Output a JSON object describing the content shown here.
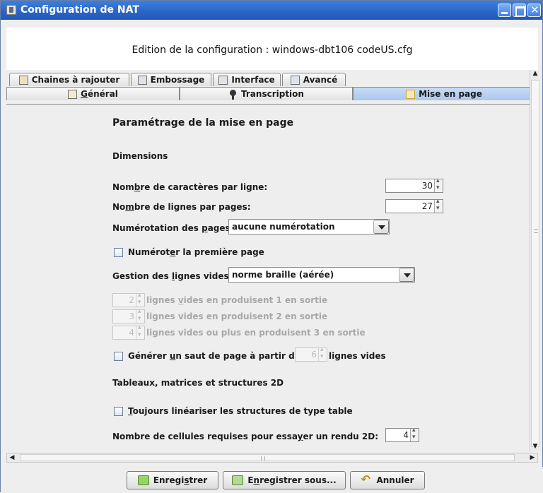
{
  "window": {
    "title": "Configuration de NAT"
  },
  "dialog": {
    "title": "Edition de la configuration : windows-dbt106 codeUS.cfg"
  },
  "tabs": {
    "row1": [
      "Chaines à rajouter",
      "Embossage",
      "Interface",
      "Avancé"
    ],
    "row2": {
      "general_pre": "",
      "general_u": "G",
      "general_post": "énéral",
      "transcription": "Transcription",
      "mise_en_page": "Mise en page"
    },
    "selected": "Mise en page"
  },
  "content": {
    "heading": "Paramétrage de la mise en page",
    "dimensions_title": "Dimensions",
    "chars_per_line": {
      "pre": "Nom",
      "u": "b",
      "post": "re de caractères par ligne:",
      "value": "30"
    },
    "lines_per_page": {
      "pre": "No",
      "u": "m",
      "post": "bre de lignes par pages:",
      "value": "27"
    },
    "page_numbering": {
      "pre": "Numérotation des ",
      "u": "p",
      "post": "ages:",
      "value": "aucune numérotation"
    },
    "number_first_page": {
      "pre": "Numérot",
      "u": "e",
      "post": "r la première page",
      "checked": false
    },
    "blank_lines": {
      "pre": "Gestion des ",
      "u": "l",
      "post": "ignes vides:",
      "value": "norme braille (aérée)"
    },
    "blank_rule_1": {
      "value": "2",
      "pre": "lignes ",
      "u": "v",
      "post": "ides en produisent 1 en sortie"
    },
    "blank_rule_2": {
      "value": "3",
      "label": "lignes vides en produisent 2 en sortie"
    },
    "blank_rule_3": {
      "value": "4",
      "label": "lignes vides ou plus en produisent 3 en sortie"
    },
    "page_break": {
      "pre": "Générer ",
      "u": "u",
      "post": "n saut de page à partir de",
      "value": "6",
      "suffix": "lignes vides",
      "checked": false
    },
    "tables_title": "Tableaux, matrices et structures 2D",
    "linearize": {
      "u": "T",
      "post": "oujours linéariser les structures de type table",
      "checked": false
    },
    "cells_required": {
      "pre": "Nombre de cellules requises pour essa",
      "u": "y",
      "post": "er un rendu 2D:",
      "value": "4"
    }
  },
  "buttons": {
    "save": {
      "pre": "Enregi",
      "u": "s",
      "post": "trer"
    },
    "save_as": {
      "pre": "E",
      "u": "n",
      "post": "registrer sous..."
    },
    "cancel": "Annuler"
  },
  "icons": [
    "app-icon",
    "minimize-icon",
    "maximize-icon",
    "close-icon",
    "chains-tab-icon",
    "embossage-tab-icon",
    "interface-tab-icon",
    "advanced-tab-icon",
    "general-tab-icon",
    "transcription-tab-icon",
    "layout-tab-icon",
    "save-icon",
    "save-as-icon",
    "cancel-icon"
  ],
  "colors": {
    "titlebar": "#2a64c5",
    "selected_tab": "#aac8ef",
    "panel": "#eeeeee"
  }
}
